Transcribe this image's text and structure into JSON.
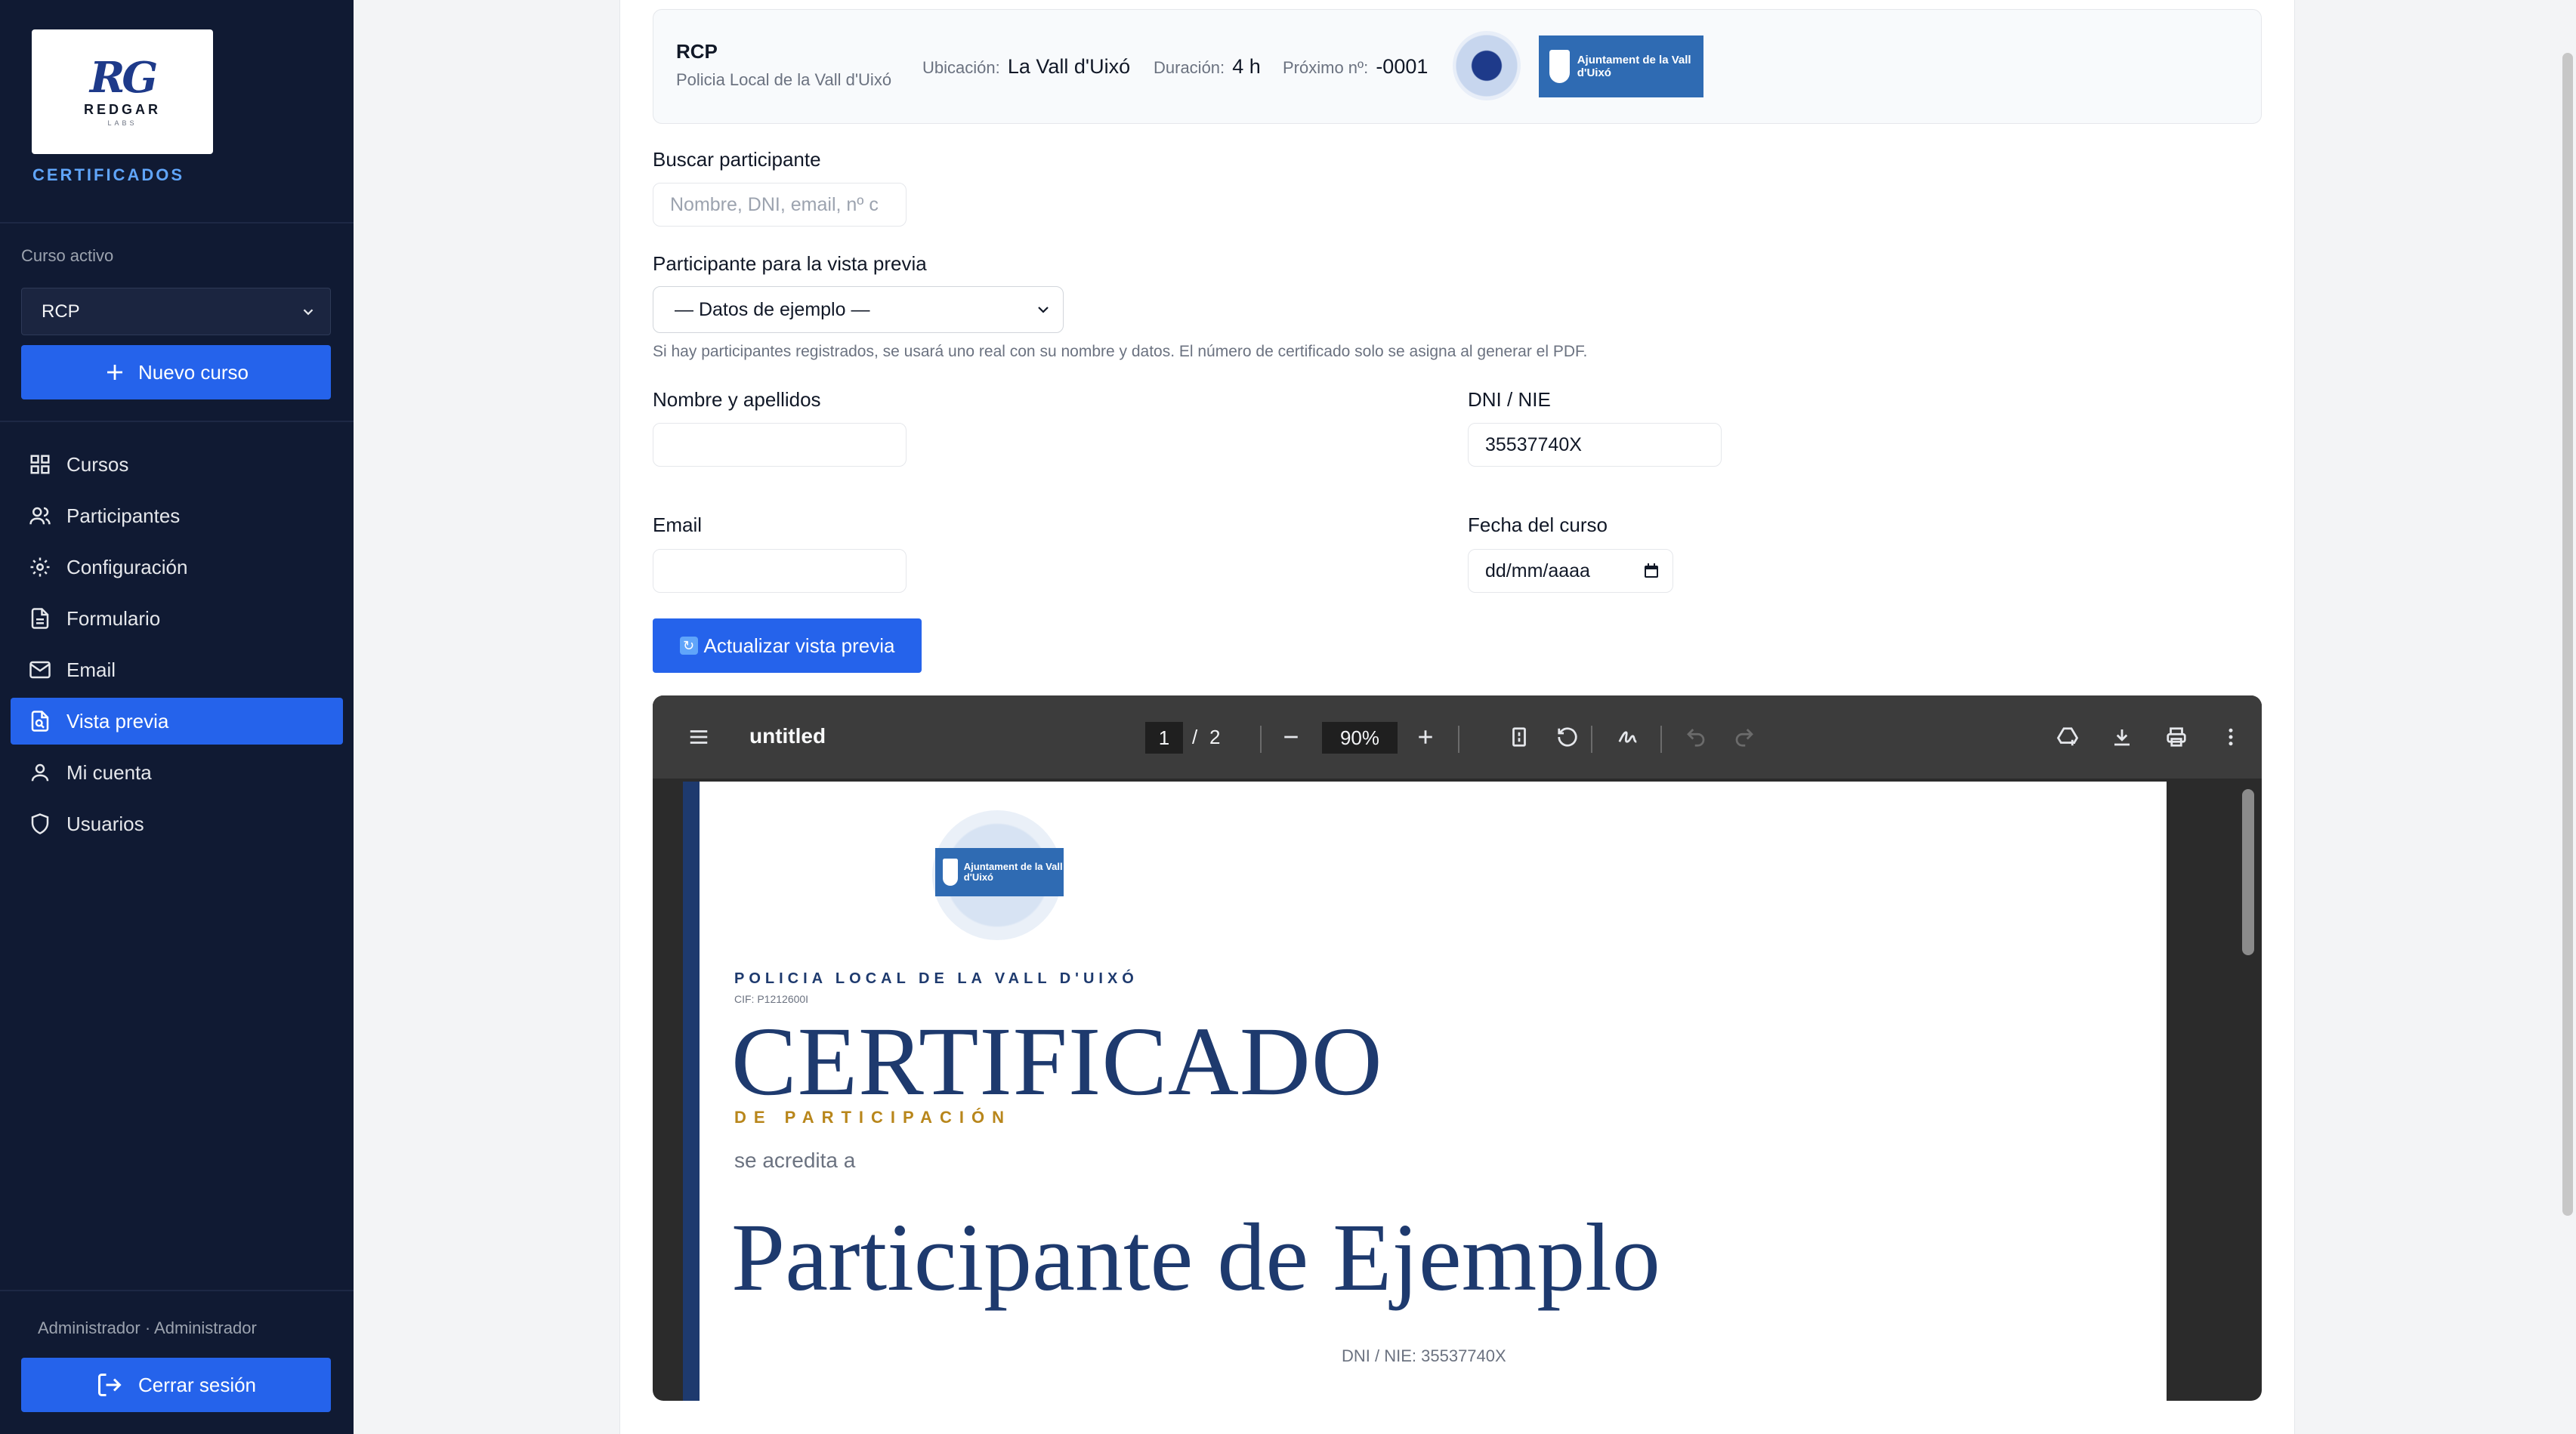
{
  "sidebar": {
    "logo": {
      "name": "REDGAR",
      "sub": "LABS"
    },
    "brand_label": "CERTIFICADOS",
    "course_label": "Curso activo",
    "course_selected": "RCP",
    "new_course_label": "Nuevo curso",
    "nav": [
      {
        "label": "Cursos",
        "icon": "grid-icon"
      },
      {
        "label": "Participantes",
        "icon": "users-icon"
      },
      {
        "label": "Configuración",
        "icon": "gear-icon"
      },
      {
        "label": "Formulario",
        "icon": "file-text-icon"
      },
      {
        "label": "Email",
        "icon": "mail-icon"
      },
      {
        "label": "Vista previa",
        "icon": "file-preview-icon",
        "active": true
      },
      {
        "label": "Mi cuenta",
        "icon": "user-icon"
      },
      {
        "label": "Usuarios",
        "icon": "shield-icon"
      }
    ],
    "role_text": "Administrador · Administrador",
    "logout_label": "Cerrar sesión"
  },
  "info": {
    "title": "RCP",
    "org": "Policia Local de la Vall d'Uixó",
    "location_label": "Ubicación:",
    "location_value": "La Vall d'Uixó",
    "duration_label": "Duración:",
    "duration_value": "4 h",
    "next_label": "Próximo nº:",
    "next_value": "-0001",
    "ayto_text": "Ajuntament de la Vall d'Uixó"
  },
  "form": {
    "search_label": "Buscar participante",
    "search_placeholder": "Nombre, DNI, email, nº c",
    "preview_label": "Participante para la vista previa",
    "preview_selected": "— Datos de ejemplo —",
    "hint": "Si hay participantes registrados, se usará uno real con su nombre y datos. El número de certificado solo se asigna al generar el PDF.",
    "name_label": "Nombre y apellidos",
    "name_value": "",
    "dni_label": "DNI / NIE",
    "dni_value": "35537740X",
    "email_label": "Email",
    "email_value": "",
    "date_label": "Fecha del curso",
    "date_value": "dd/mm/aaaa",
    "refresh_label": "Actualizar vista previa"
  },
  "pdf": {
    "title": "untitled",
    "page_current": "1",
    "page_sep": "/",
    "page_total": "2",
    "zoom": "90%"
  },
  "certificate": {
    "org": "POLICIA LOCAL DE LA VALL D'UIXÓ",
    "cif": "CIF: P1212600I",
    "title": "CERTIFICADO",
    "subtitle": "DE PARTICIPACIÓN",
    "accredits": "se acredita a",
    "participant": "Participante de Ejemplo",
    "dni_line": "DNI / NIE: 35537740X",
    "ayto_text": "Ajuntament de la Vall d'Uixó"
  },
  "colors": {
    "sidebar_bg": "#101a33",
    "accent": "#2563eb",
    "brand_label": "#60a5fa",
    "cert_navy": "#1e3a6e",
    "cert_gold": "#b8861b"
  }
}
